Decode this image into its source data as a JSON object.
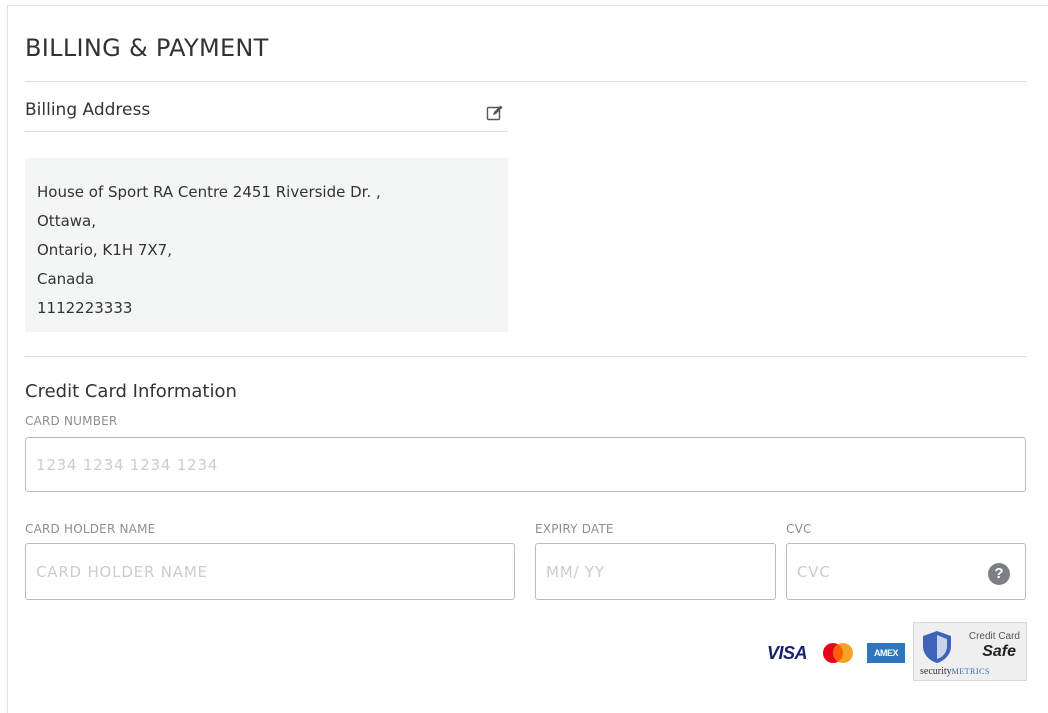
{
  "header": {
    "title": "BILLING & PAYMENT"
  },
  "billing": {
    "label": "Billing Address",
    "address_lines": [
      "House of Sport RA Centre 2451 Riverside Dr. ,",
      "Ottawa,",
      "Ontario, K1H 7X7,",
      "Canada",
      "1112223333"
    ]
  },
  "credit_card": {
    "title": "Credit Card Information",
    "card_number": {
      "label": "CARD NUMBER",
      "placeholder": "1234 1234 1234 1234",
      "value": ""
    },
    "holder_name": {
      "label": "CARD HOLDER NAME",
      "placeholder": "CARD HOLDER NAME",
      "value": ""
    },
    "expiry": {
      "label": "EXPIRY DATE",
      "placeholder": "MM/ YY",
      "value": ""
    },
    "cvc": {
      "label": "CVC",
      "placeholder": "CVC",
      "value": "",
      "help_icon": "question-circle-icon",
      "help_glyph": "?"
    }
  },
  "payment_logos": {
    "visa": "VISA",
    "amex": "AMEX",
    "mastercard_colors": [
      "#eb001b",
      "#f79e1b"
    ],
    "badge": {
      "line1": "Credit Card",
      "line2": "Safe",
      "line3a": "security",
      "line3b": "METRICS"
    }
  },
  "colors": {
    "text": "#333333",
    "muted_label": "#8a8f96",
    "border": "#b8bcc2",
    "address_bg": "#f4f5f5",
    "visa_blue": "#1a1f71",
    "amex_blue": "#2e77bc"
  }
}
